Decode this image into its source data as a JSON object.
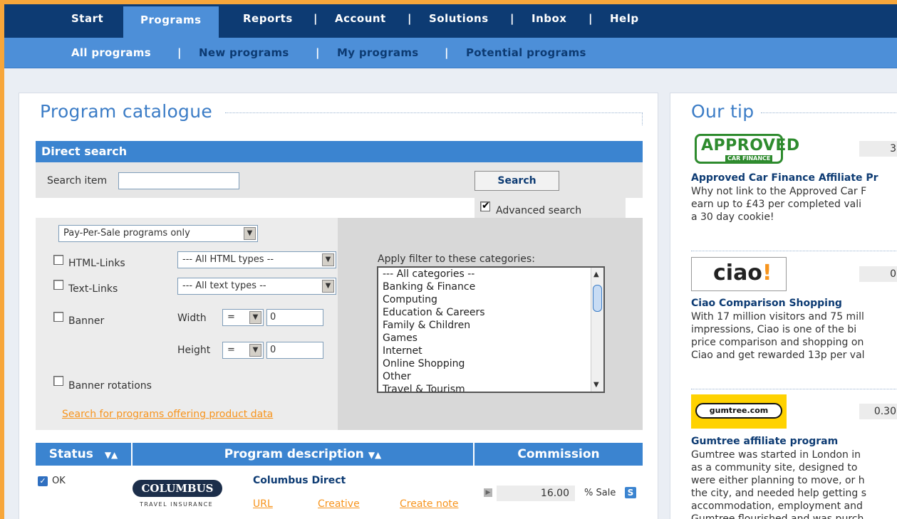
{
  "nav": {
    "items": [
      "Start",
      "Programs",
      "Reports",
      "Account",
      "Solutions",
      "Inbox",
      "Help"
    ],
    "active": "Programs"
  },
  "subnav": {
    "items": [
      "All programs",
      "New programs",
      "My programs",
      "Potential programs"
    ],
    "active": "All programs"
  },
  "catalogue": {
    "title": "Program catalogue",
    "direct_search": {
      "header": "Direct search",
      "search_item_label": "Search item",
      "search_value": "",
      "search_button": "Search",
      "advanced_label": "Advanced search",
      "advanced_checked": true
    },
    "filters": {
      "program_type": "Pay-Per-Sale programs only",
      "html_links_label": "HTML-Links",
      "html_types": "--- All HTML types --",
      "text_links_label": "Text-Links",
      "text_types": "--- All text types --",
      "banner_label": "Banner",
      "width_label": "Width",
      "width_op": "=",
      "width_value": "0",
      "height_label": "Height",
      "height_op": "=",
      "height_value": "0",
      "banner_rotations_label": "Banner rotations",
      "product_data_link": "Search for programs offering product data",
      "categories_label": "Apply filter to these categories:",
      "categories": [
        "--- All categories --",
        "Banking & Finance",
        "Computing",
        "Education & Careers",
        "Family & Children",
        "Games",
        "Internet",
        "Online Shopping",
        "Other",
        "Travel & Tourism"
      ]
    },
    "table": {
      "col_status": "Status",
      "col_description": "Program description",
      "col_commission": "Commission",
      "rows": [
        {
          "status": "OK",
          "logo_text": "COLUMBUS",
          "logo_sub": "TRAVEL INSURANCE",
          "name": "Columbus Direct",
          "link_url": "URL",
          "link_creative": "Creative",
          "link_note": "Create note",
          "commission_value": "16.00",
          "commission_unit": "% Sale",
          "badge": "S"
        }
      ]
    }
  },
  "tip": {
    "title": "Our tip",
    "items": [
      {
        "logo_text": "APPROVED",
        "logo_sub": "CAR FINANCE",
        "value": "3",
        "title": "Approved Car Finance Affiliate Pr",
        "lines": [
          "Why not link to the Approved Car F",
          "earn up to £43 per completed vali",
          "a 30 day cookie!"
        ]
      },
      {
        "logo_text": "ciao",
        "value": "0",
        "title": "Ciao Comparison Shopping",
        "lines": [
          "With 17 million visitors and 75 mill",
          "impressions, Ciao is one of the bi",
          "price comparison and shopping on",
          "Ciao and get rewarded 13p per val"
        ]
      },
      {
        "logo_text": "gumtree.com",
        "value": "0.30",
        "title": "Gumtree affiliate program",
        "lines": [
          "Gumtree was started in London in",
          "as a community site, designed to",
          "were either planning to move, or h",
          "the city, and needed help getting s",
          "accommodation, employment and",
          "Gumtree flourished and was purch"
        ]
      }
    ]
  }
}
